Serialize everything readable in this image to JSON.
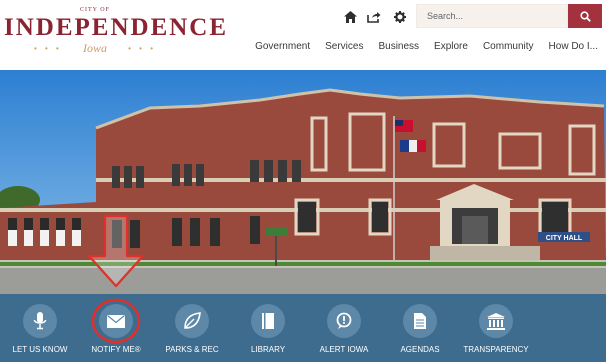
{
  "logo": {
    "city_of": "CITY OF",
    "name": "INDEPENDENCE",
    "state": "Iowa"
  },
  "utility": {
    "icons": [
      "home-icon",
      "share-icon",
      "gear-icon"
    ]
  },
  "search": {
    "placeholder": "Search...",
    "button_icon": "search-icon"
  },
  "nav": {
    "items": [
      "Government",
      "Services",
      "Business",
      "Explore",
      "Community",
      "How Do I..."
    ]
  },
  "hero": {
    "sign_text": "CITY HALL"
  },
  "quicklinks": {
    "items": [
      {
        "label": "LET US KNOW",
        "icon": "microphone-icon"
      },
      {
        "label": "NOTIFY ME®",
        "icon": "envelope-icon"
      },
      {
        "label": "PARKS & REC",
        "icon": "leaf-icon"
      },
      {
        "label": "LIBRARY",
        "icon": "book-icon"
      },
      {
        "label": "ALERT IOWA",
        "icon": "alert-bubble-icon"
      },
      {
        "label": "AGENDAS",
        "icon": "document-icon"
      },
      {
        "label": "TRANSPARENCY",
        "icon": "building-icon"
      }
    ]
  },
  "colors": {
    "brand": "#8a2432",
    "accent_gold": "#c9a06a",
    "search_button": "#a3323e",
    "quicklinks_bar": "#3e6c8e",
    "annotation": "#e0302a"
  }
}
